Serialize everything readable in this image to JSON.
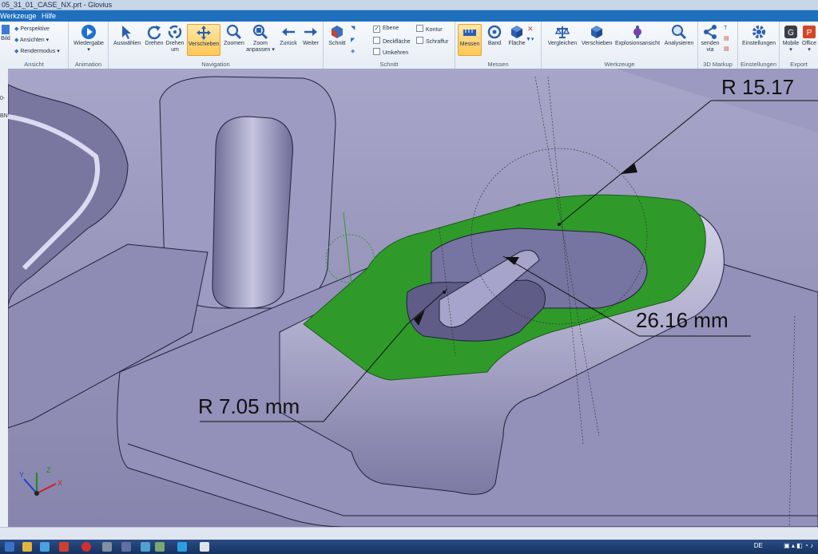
{
  "window": {
    "title": "05_31_01_CASE_NX.prt - Glovius"
  },
  "menu": {
    "items": [
      "Werkzeuge",
      "Hilfe"
    ]
  },
  "ribbon": {
    "groups": {
      "ansicht": "Ansicht",
      "animation": "Animation",
      "navigation": "Navigation",
      "schnitt": "Schnitt",
      "messen": "Messen",
      "werkzeuge": "Werkzeuge",
      "markup": "3D Markup",
      "einstellungen": "Einstellungen",
      "export": "Export"
    },
    "ansicht": {
      "bild": "Bild",
      "perspektive": "Perspektive",
      "ansichten": "Ansichten ▾",
      "rendermodus": "Rendermodus ▾"
    },
    "animation": {
      "wiedergabe": "Wiedergabe"
    },
    "navigation": {
      "auswaehlen": "Auswählen",
      "drehen": "Drehen",
      "drehen_um": "Drehen um",
      "verschieben": "Verschieben",
      "zoomen": "Zoomen",
      "zoom_anpassen": "Zoom anpassen ▾",
      "zurueck": "Zurück",
      "weiter": "Weiter"
    },
    "schnitt": {
      "schnitt": "Schnitt",
      "ebene": "Ebene",
      "deckflaeche": "Deckfläche",
      "umkehren": "Umkehren",
      "kontur": "Kontur",
      "schraffur": "Schraffur"
    },
    "messen": {
      "messen": "Messen",
      "band": "Band",
      "flaeche": "Fläche"
    },
    "werkzeuge": {
      "vergleichen": "Vergleichen",
      "verschieben": "Verschieben",
      "explosionsansicht": "Explosionsansicht",
      "analysieren": "Analysieren"
    },
    "markup": {
      "senden": "senden via"
    },
    "einstellungen": {
      "einstellungen": "Einstellungen"
    },
    "export": {
      "mobile": "Mobile",
      "office": "Office"
    }
  },
  "viewport": {
    "dimensions": {
      "radius_large": "R 15.17",
      "distance": "26.16 mm",
      "radius_small": "R 7.05 mm"
    },
    "triad": {
      "x": "X",
      "y": "Y",
      "z": "Z"
    }
  },
  "leftstrip": {
    "a": "0-",
    "b": "BN"
  },
  "taskbar": {
    "lang": "DE"
  },
  "colors": {
    "model": "#8a87b0",
    "selected_face": "#2f9a2a",
    "ribbon_accent": "#ffc856"
  }
}
